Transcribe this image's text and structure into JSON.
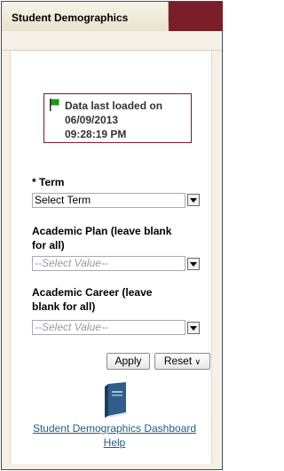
{
  "panel": {
    "title": "Student Demographics"
  },
  "status": {
    "label": "Data last loaded on",
    "date": "06/09/2013",
    "time": "09:28:19 PM",
    "flag_color": "#1a9a1a"
  },
  "filters": {
    "term": {
      "label": "* Term",
      "value": "Select Term"
    },
    "academic_plan": {
      "label_line1": "Academic Plan (leave blank",
      "label_line2": "for all)",
      "value": "--Select Value--"
    },
    "academic_career": {
      "label_line1": "Academic Career (leave",
      "label_line2": "blank for all)",
      "value": "--Select Value--"
    }
  },
  "buttons": {
    "apply": "Apply",
    "reset": "Reset",
    "reset_icon": "chevron-down-icon"
  },
  "help": {
    "icon": "book-icon",
    "line1": "Student Demographics Dashboard",
    "line2": "Help"
  },
  "colors": {
    "accent": "#7a1e2a",
    "link": "#1f5f85",
    "panel_bg": "#f5f1e6"
  }
}
